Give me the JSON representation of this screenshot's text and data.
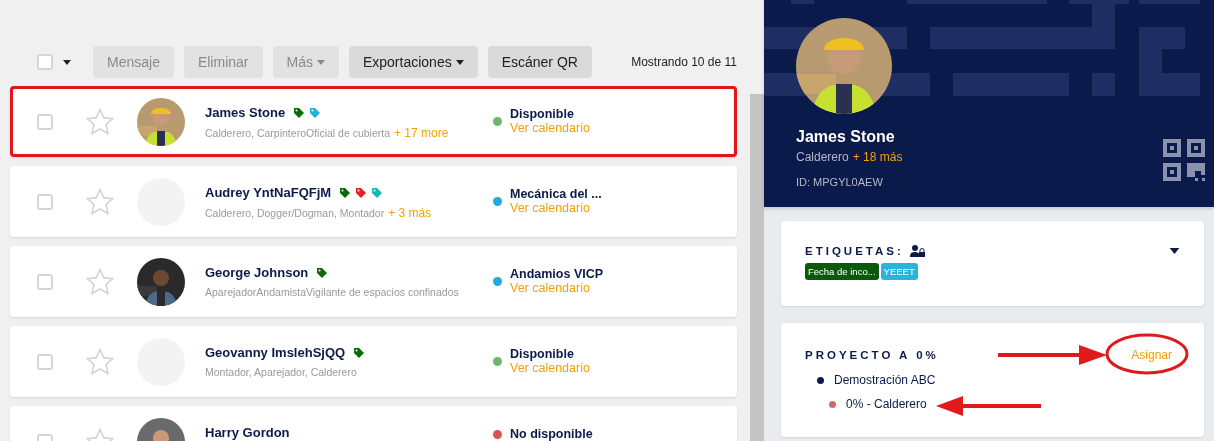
{
  "toolbar": {
    "select_all_checked": false,
    "buttons": [
      {
        "label": "Mensaje",
        "disabled": true,
        "dropdown": false
      },
      {
        "label": "Eliminar",
        "disabled": true,
        "dropdown": false
      },
      {
        "label": "Más",
        "disabled": true,
        "dropdown": true
      },
      {
        "label": "Exportaciones",
        "disabled": false,
        "dropdown": true
      },
      {
        "label": "Escáner QR",
        "disabled": false,
        "dropdown": false
      }
    ],
    "count": "Mostrando 10 de 11"
  },
  "workers": [
    {
      "name": "James Stone",
      "tags": [
        {
          "color": "#0b6b0b"
        },
        {
          "color": "#22b0dc"
        }
      ],
      "trades": "Calderero, CarpinteroOficial de cubierta",
      "more": "+ 17 more",
      "status": {
        "label": "Disponible",
        "color": "#6cb86a"
      },
      "calendar_link": "Ver calendario",
      "has_photo": true,
      "checked": false,
      "starred": false,
      "highlighted": true
    },
    {
      "name": "Audrey YntNaFQFjM",
      "tags": [
        {
          "color": "#0b6b0b"
        },
        {
          "color": "#e02424"
        },
        {
          "color": "#14b8b8"
        }
      ],
      "trades": "Calderero, Dogger/Dogman, Montador",
      "more": "+ 3 más",
      "status": {
        "label": "Mecánica del ...",
        "color": "#22a8dc"
      },
      "calendar_link": "Ver calendario",
      "has_photo": false,
      "checked": false,
      "starred": false,
      "highlighted": false
    },
    {
      "name": "George Johnson",
      "tags": [
        {
          "color": "#0b6b0b"
        }
      ],
      "trades": "AparejadorAndamistaVigilante de espacios confinados",
      "status": {
        "label": "Andamios VICP",
        "color": "#22a8dc"
      },
      "calendar_link": "Ver calendario",
      "has_photo": true,
      "checked": false,
      "starred": false,
      "highlighted": false
    },
    {
      "name": "Geovanny ImslehSjQQ",
      "tags": [
        {
          "color": "#0b6b0b"
        }
      ],
      "trades": "Montador, Aparejador, Calderero",
      "status": {
        "label": "Disponible",
        "color": "#6cb86a"
      },
      "calendar_link": "Ver calendario",
      "has_photo": false,
      "checked": false,
      "starred": false,
      "highlighted": false
    },
    {
      "name": "Harry Gordon",
      "status": {
        "label": "No disponible",
        "color": "#d9534f"
      },
      "has_photo": true,
      "checked": false,
      "starred": false,
      "highlighted": false
    }
  ],
  "profile": {
    "name": "James Stone",
    "trade": "Calderero",
    "more": "+ 18 más",
    "id": "ID: MPGYL0AEW"
  },
  "labels_card": {
    "title": "ETIQUETAS:",
    "expanded": false,
    "tags": [
      {
        "label": "Fecha de inco...",
        "color": "#0b5a0b"
      },
      {
        "label": "YEEET",
        "color": "#2ab4dc"
      }
    ]
  },
  "project_card": {
    "title": "PROYECTO A 0%",
    "action": "Asignar",
    "annotated": true,
    "projects": [
      {
        "name": "Demostración ABC",
        "color": "#0b1a4a",
        "roles": [
          {
            "label": "0% - Calderero",
            "color": "#cf6a6a"
          }
        ]
      }
    ]
  }
}
